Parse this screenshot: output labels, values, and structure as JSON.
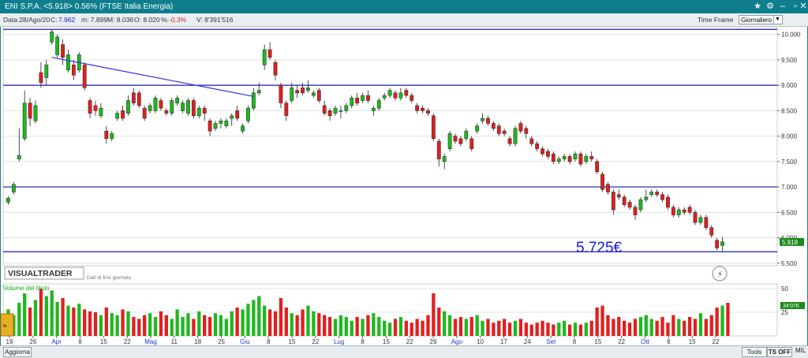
{
  "window": {
    "title": "ENI S.P.A. <5.918> 0.56% (FTSE Italia Energia)",
    "star_icon": "star-icon",
    "settings_icon": "gear-icon"
  },
  "infobar": {
    "date": "Data:28/Ago/20",
    "close_label": "C:",
    "close_value": "7.962",
    "min": "m: 7.899",
    "max": "M: 8.036",
    "open": "O: 8.020",
    "change_label": "%:",
    "change_value": "-0.3%",
    "volume": "V: 8'391'516",
    "timeframe_label": "Time Frame",
    "timeframe_value": "Giornaliero"
  },
  "watermark": {
    "brand": "VISUALTRADER",
    "note": "Dati di fine giornata"
  },
  "annotation": {
    "price_label": "5.725€"
  },
  "volume_panel": {
    "title": "Volume del titolo",
    "last_value": "34'076"
  },
  "bottombar": {
    "update": "Aggiorna",
    "tools": "Tools",
    "ts_off": "TS OFF",
    "mil_label": "MIL"
  },
  "colors": {
    "up": "#1fb81f",
    "down": "#e02020",
    "hline": "#1a1ab8",
    "trendline": "#3030e0",
    "titlebar": "#0e7e8e",
    "annotation": "#1a1ae0"
  },
  "chart_data": {
    "type": "candlestick",
    "series_name": "ENI S.P.A.",
    "ylim": [
      5.45,
      10.15
    ],
    "yticks": [
      "10.000",
      "9.500",
      "9.000",
      "8.500",
      "8.000",
      "7.500",
      "7.000",
      "6.500",
      "6.000",
      "5.500"
    ],
    "last_price": "5.918",
    "xticks": [
      "19",
      "26",
      "Apr",
      "8",
      "15",
      "22",
      "Mag",
      "11",
      "18",
      "25",
      "Giu",
      "8",
      "15",
      "22",
      "Lug",
      "8",
      "15",
      "22",
      "29",
      "Ago",
      "10",
      "17",
      "24",
      "Set",
      "8",
      "15",
      "22",
      "Ott",
      "8",
      "15",
      "22"
    ],
    "horizontal_lines": [
      10.1,
      9.0,
      7.0,
      5.725
    ],
    "trendline": {
      "from": [
        8,
        9.55
      ],
      "to": [
        45,
        8.78
      ]
    },
    "candles": [
      [
        6.7,
        6.78,
        6.65,
        6.82
      ],
      [
        6.9,
        7.05,
        6.85,
        7.1
      ],
      [
        7.55,
        7.62,
        7.5,
        8.15
      ],
      [
        7.95,
        8.65,
        7.9,
        8.9
      ],
      [
        8.65,
        8.35,
        8.2,
        8.75
      ],
      [
        8.3,
        8.6,
        8.25,
        8.7
      ],
      [
        9.25,
        9.05,
        8.95,
        9.45
      ],
      [
        9.15,
        9.4,
        9.0,
        9.5
      ],
      [
        9.85,
        10.05,
        9.8,
        10.1
      ],
      [
        9.6,
        9.95,
        9.55,
        10.0
      ],
      [
        9.8,
        9.55,
        9.4,
        9.9
      ],
      [
        9.3,
        9.6,
        9.25,
        9.7
      ],
      [
        9.4,
        9.2,
        9.1,
        9.5
      ],
      [
        9.3,
        9.6,
        9.25,
        9.65
      ],
      [
        9.4,
        8.95,
        8.9,
        9.45
      ],
      [
        8.7,
        8.45,
        8.35,
        8.75
      ],
      [
        8.6,
        8.5,
        8.4,
        8.7
      ],
      [
        8.4,
        8.55,
        8.35,
        8.65
      ],
      [
        8.1,
        7.95,
        7.85,
        8.2
      ],
      [
        7.95,
        8.05,
        7.9,
        8.1
      ],
      [
        8.35,
        8.45,
        8.3,
        8.5
      ],
      [
        8.5,
        8.35,
        8.3,
        8.6
      ],
      [
        8.45,
        8.7,
        8.4,
        8.8
      ],
      [
        8.85,
        8.65,
        8.6,
        8.95
      ],
      [
        8.85,
        8.6,
        8.55,
        8.9
      ],
      [
        8.55,
        8.35,
        8.3,
        8.6
      ],
      [
        8.5,
        8.6,
        8.45,
        8.65
      ],
      [
        8.5,
        8.75,
        8.45,
        8.8
      ],
      [
        8.7,
        8.55,
        8.5,
        8.75
      ],
      [
        8.5,
        8.45,
        8.4,
        8.55
      ],
      [
        8.45,
        8.7,
        8.4,
        8.75
      ],
      [
        8.65,
        8.75,
        8.6,
        8.8
      ],
      [
        8.5,
        8.65,
        8.45,
        8.7
      ],
      [
        8.45,
        8.7,
        8.4,
        8.75
      ],
      [
        8.7,
        8.4,
        8.35,
        8.75
      ],
      [
        8.4,
        8.55,
        8.35,
        8.6
      ],
      [
        8.55,
        8.45,
        8.3,
        8.6
      ],
      [
        8.3,
        8.1,
        8.0,
        8.35
      ],
      [
        8.15,
        8.25,
        8.1,
        8.3
      ],
      [
        8.25,
        8.3,
        8.15,
        8.35
      ],
      [
        8.2,
        8.3,
        8.15,
        8.35
      ],
      [
        8.35,
        8.4,
        8.2,
        8.45
      ],
      [
        8.5,
        8.35,
        8.3,
        8.6
      ],
      [
        8.1,
        8.2,
        8.05,
        8.25
      ],
      [
        8.3,
        8.55,
        8.25,
        8.6
      ],
      [
        8.55,
        8.85,
        8.5,
        8.95
      ],
      [
        8.85,
        8.9,
        8.8,
        9.05
      ],
      [
        9.4,
        9.7,
        9.3,
        9.8
      ],
      [
        9.7,
        9.55,
        9.5,
        9.85
      ],
      [
        9.45,
        9.2,
        9.1,
        9.5
      ],
      [
        9.0,
        8.65,
        8.55,
        9.05
      ],
      [
        8.65,
        8.4,
        8.3,
        8.7
      ],
      [
        8.7,
        8.95,
        8.65,
        9.05
      ],
      [
        8.9,
        8.85,
        8.75,
        9.0
      ],
      [
        8.95,
        8.85,
        8.8,
        9.05
      ],
      [
        8.9,
        8.95,
        8.85,
        9.1
      ],
      [
        8.8,
        8.85,
        8.75,
        8.9
      ],
      [
        8.9,
        8.7,
        8.65,
        8.95
      ],
      [
        8.6,
        8.45,
        8.4,
        8.7
      ],
      [
        8.5,
        8.4,
        8.3,
        8.55
      ],
      [
        8.45,
        8.55,
        8.4,
        8.6
      ],
      [
        8.5,
        8.5,
        8.35,
        8.6
      ],
      [
        8.5,
        8.6,
        8.45,
        8.65
      ],
      [
        8.6,
        8.75,
        8.55,
        8.8
      ],
      [
        8.75,
        8.65,
        8.6,
        8.85
      ],
      [
        8.7,
        8.8,
        8.65,
        8.85
      ],
      [
        8.8,
        8.7,
        8.65,
        8.9
      ],
      [
        8.5,
        8.55,
        8.4,
        8.6
      ],
      [
        8.55,
        8.7,
        8.5,
        8.75
      ],
      [
        8.75,
        8.8,
        8.7,
        8.85
      ],
      [
        8.8,
        8.9,
        8.75,
        8.95
      ],
      [
        8.85,
        8.75,
        8.7,
        8.9
      ],
      [
        8.75,
        8.85,
        8.7,
        8.95
      ],
      [
        8.9,
        8.8,
        8.75,
        8.95
      ],
      [
        8.8,
        8.7,
        8.65,
        8.85
      ],
      [
        8.6,
        8.5,
        8.45,
        8.65
      ],
      [
        8.55,
        8.5,
        8.45,
        8.6
      ],
      [
        8.5,
        8.45,
        8.4,
        8.55
      ],
      [
        8.4,
        7.95,
        7.9,
        8.45
      ],
      [
        7.9,
        7.55,
        7.4,
        7.95
      ],
      [
        7.5,
        7.6,
        7.35,
        7.65
      ],
      [
        7.75,
        8.05,
        7.7,
        8.1
      ],
      [
        8.0,
        7.9,
        7.85,
        8.05
      ],
      [
        7.95,
        7.85,
        7.8,
        8.0
      ],
      [
        7.95,
        8.1,
        7.9,
        8.15
      ],
      [
        7.95,
        7.75,
        7.7,
        8.0
      ],
      [
        8.1,
        8.2,
        8.05,
        8.25
      ],
      [
        8.3,
        8.35,
        8.25,
        8.45
      ],
      [
        8.35,
        8.25,
        8.2,
        8.4
      ],
      [
        8.25,
        8.15,
        8.1,
        8.3
      ],
      [
        8.2,
        8.05,
        8.0,
        8.25
      ],
      [
        8.1,
        8.05,
        8.0,
        8.15
      ],
      [
        7.95,
        7.85,
        7.8,
        8.0
      ],
      [
        7.85,
        8.15,
        7.8,
        8.2
      ],
      [
        8.25,
        8.1,
        8.05,
        8.3
      ],
      [
        8.15,
        8.05,
        7.95,
        8.2
      ],
      [
        7.95,
        7.85,
        7.8,
        8.0
      ],
      [
        7.85,
        7.75,
        7.7,
        7.9
      ],
      [
        7.75,
        7.65,
        7.6,
        7.8
      ],
      [
        7.7,
        7.6,
        7.55,
        7.75
      ],
      [
        7.65,
        7.5,
        7.45,
        7.7
      ],
      [
        7.5,
        7.55,
        7.45,
        7.6
      ],
      [
        7.55,
        7.6,
        7.5,
        7.65
      ],
      [
        7.6,
        7.5,
        7.45,
        7.65
      ],
      [
        7.55,
        7.65,
        7.5,
        7.7
      ],
      [
        7.65,
        7.45,
        7.4,
        7.7
      ],
      [
        7.5,
        7.6,
        7.45,
        7.65
      ],
      [
        7.6,
        7.55,
        7.5,
        7.7
      ],
      [
        7.5,
        7.3,
        7.25,
        7.55
      ],
      [
        7.25,
        6.95,
        6.9,
        7.3
      ],
      [
        7.05,
        6.9,
        6.85,
        7.1
      ],
      [
        6.9,
        6.55,
        6.45,
        6.95
      ],
      [
        6.85,
        6.8,
        6.75,
        6.95
      ],
      [
        6.8,
        6.65,
        6.6,
        6.85
      ],
      [
        6.7,
        6.6,
        6.55,
        6.75
      ],
      [
        6.6,
        6.45,
        6.35,
        6.65
      ],
      [
        6.55,
        6.75,
        6.5,
        6.8
      ],
      [
        6.75,
        6.8,
        6.7,
        6.95
      ],
      [
        6.85,
        6.9,
        6.8,
        6.95
      ],
      [
        6.9,
        6.85,
        6.8,
        6.95
      ],
      [
        6.85,
        6.75,
        6.7,
        6.9
      ],
      [
        6.8,
        6.6,
        6.55,
        6.85
      ],
      [
        6.6,
        6.45,
        6.4,
        6.65
      ],
      [
        6.45,
        6.55,
        6.4,
        6.6
      ],
      [
        6.55,
        6.5,
        6.45,
        6.6
      ],
      [
        6.6,
        6.5,
        6.45,
        6.65
      ],
      [
        6.5,
        6.3,
        6.25,
        6.55
      ],
      [
        6.3,
        6.4,
        6.25,
        6.45
      ],
      [
        6.4,
        6.2,
        6.15,
        6.45
      ],
      [
        6.2,
        6.05,
        6.0,
        6.25
      ],
      [
        5.95,
        5.8,
        5.75,
        6.0
      ],
      [
        5.85,
        5.92,
        5.72,
        6.02
      ]
    ],
    "volume": [
      28,
      22,
      35,
      45,
      30,
      38,
      50,
      42,
      48,
      36,
      40,
      32,
      30,
      34,
      28,
      26,
      25,
      22,
      30,
      24,
      22,
      28,
      26,
      20,
      18,
      22,
      24,
      20,
      26,
      22,
      18,
      28,
      20,
      24,
      18,
      26,
      22,
      20,
      24,
      22,
      18,
      26,
      30,
      28,
      34,
      38,
      42,
      32,
      28,
      26,
      40,
      30,
      24,
      22,
      28,
      32,
      26,
      24,
      22,
      20,
      18,
      22,
      20,
      16,
      20,
      18,
      22,
      24,
      20,
      16,
      14,
      18,
      20,
      16,
      14,
      18,
      16,
      22,
      45,
      30,
      26,
      22,
      18,
      20,
      18,
      20,
      22,
      16,
      18,
      14,
      16,
      18,
      14,
      16,
      18,
      14,
      12,
      14,
      16,
      14,
      12,
      14,
      16,
      12,
      14,
      12,
      14,
      16,
      30,
      32,
      22,
      18,
      20,
      16,
      14,
      18,
      20,
      22,
      18,
      16,
      20,
      14,
      22,
      18,
      16,
      20,
      18,
      24,
      18,
      22,
      30,
      32,
      35
    ]
  }
}
